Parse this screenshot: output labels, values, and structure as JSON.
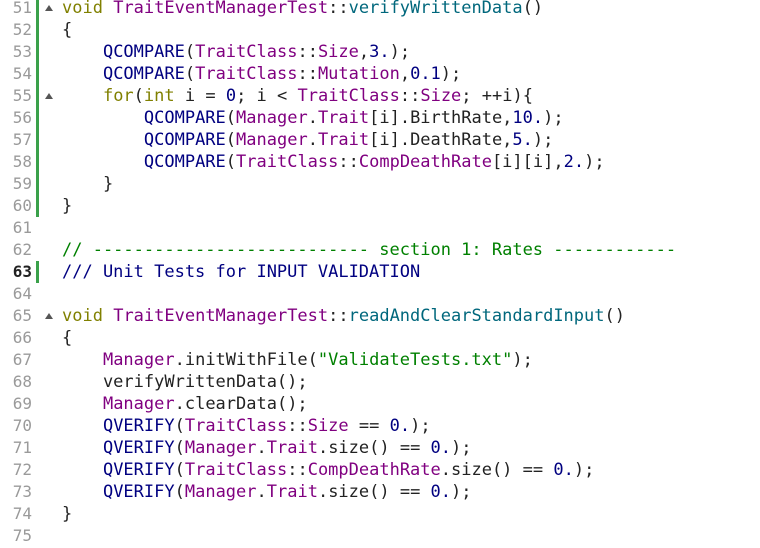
{
  "editor": {
    "current_line": "63",
    "lines": [
      {
        "no": "51",
        "fold": true,
        "changed": true,
        "tokens": [
          [
            "kw",
            "void"
          ],
          [
            "txt",
            " "
          ],
          [
            "cls",
            "TraitEventManagerTest"
          ],
          [
            "txt",
            "::"
          ],
          [
            "fn-def",
            "verifyWrittenData"
          ],
          [
            "txt",
            "()"
          ]
        ]
      },
      {
        "no": "52",
        "fold": false,
        "changed": true,
        "tokens": [
          [
            "txt",
            "{"
          ]
        ]
      },
      {
        "no": "53",
        "fold": false,
        "changed": true,
        "tokens": [
          [
            "txt",
            "    "
          ],
          [
            "mac",
            "QCOMPARE"
          ],
          [
            "txt",
            "("
          ],
          [
            "cls",
            "TraitClass"
          ],
          [
            "txt",
            "::"
          ],
          [
            "cls",
            "Size"
          ],
          [
            "txt",
            ","
          ],
          [
            "num",
            "3."
          ],
          [
            "txt",
            ");"
          ]
        ]
      },
      {
        "no": "54",
        "fold": false,
        "changed": true,
        "tokens": [
          [
            "txt",
            "    "
          ],
          [
            "mac",
            "QCOMPARE"
          ],
          [
            "txt",
            "("
          ],
          [
            "cls",
            "TraitClass"
          ],
          [
            "txt",
            "::"
          ],
          [
            "cls",
            "Mutation"
          ],
          [
            "txt",
            ","
          ],
          [
            "num",
            "0.1"
          ],
          [
            "txt",
            ");"
          ]
        ]
      },
      {
        "no": "55",
        "fold": true,
        "changed": true,
        "tokens": [
          [
            "txt",
            "    "
          ],
          [
            "kw",
            "for"
          ],
          [
            "txt",
            "("
          ],
          [
            "kw",
            "int"
          ],
          [
            "txt",
            " i = "
          ],
          [
            "num",
            "0"
          ],
          [
            "txt",
            "; i < "
          ],
          [
            "cls",
            "TraitClass"
          ],
          [
            "txt",
            "::"
          ],
          [
            "cls",
            "Size"
          ],
          [
            "txt",
            "; ++i){"
          ]
        ]
      },
      {
        "no": "56",
        "fold": false,
        "changed": true,
        "tokens": [
          [
            "txt",
            "        "
          ],
          [
            "mac",
            "QCOMPARE"
          ],
          [
            "txt",
            "("
          ],
          [
            "cls",
            "Manager"
          ],
          [
            "txt",
            "."
          ],
          [
            "cls",
            "Trait"
          ],
          [
            "txt",
            "[i].BirthRate,"
          ],
          [
            "num",
            "10."
          ],
          [
            "txt",
            ");"
          ]
        ]
      },
      {
        "no": "57",
        "fold": false,
        "changed": true,
        "tokens": [
          [
            "txt",
            "        "
          ],
          [
            "mac",
            "QCOMPARE"
          ],
          [
            "txt",
            "("
          ],
          [
            "cls",
            "Manager"
          ],
          [
            "txt",
            "."
          ],
          [
            "cls",
            "Trait"
          ],
          [
            "txt",
            "[i].DeathRate,"
          ],
          [
            "num",
            "5."
          ],
          [
            "txt",
            ");"
          ]
        ]
      },
      {
        "no": "58",
        "fold": false,
        "changed": true,
        "tokens": [
          [
            "txt",
            "        "
          ],
          [
            "mac",
            "QCOMPARE"
          ],
          [
            "txt",
            "("
          ],
          [
            "cls",
            "TraitClass"
          ],
          [
            "txt",
            "::"
          ],
          [
            "cls",
            "CompDeathRate"
          ],
          [
            "txt",
            "[i][i],"
          ],
          [
            "num",
            "2."
          ],
          [
            "txt",
            ");"
          ]
        ]
      },
      {
        "no": "59",
        "fold": false,
        "changed": true,
        "tokens": [
          [
            "txt",
            "    }"
          ]
        ]
      },
      {
        "no": "60",
        "fold": false,
        "changed": true,
        "tokens": [
          [
            "txt",
            "}"
          ]
        ]
      },
      {
        "no": "61",
        "fold": false,
        "changed": false,
        "tokens": []
      },
      {
        "no": "62",
        "fold": false,
        "changed": false,
        "tokens": [
          [
            "com",
            "// --------------------------- section 1: Rates ------------"
          ]
        ]
      },
      {
        "no": "63",
        "fold": false,
        "changed": true,
        "tokens": [
          [
            "com-doc",
            "/// Unit Tests for INPUT VALIDATION"
          ]
        ]
      },
      {
        "no": "64",
        "fold": false,
        "changed": false,
        "tokens": []
      },
      {
        "no": "65",
        "fold": true,
        "changed": false,
        "tokens": [
          [
            "kw",
            "void"
          ],
          [
            "txt",
            " "
          ],
          [
            "cls",
            "TraitEventManagerTest"
          ],
          [
            "txt",
            "::"
          ],
          [
            "fn-def",
            "readAndClearStandardInput"
          ],
          [
            "txt",
            "()"
          ]
        ]
      },
      {
        "no": "66",
        "fold": false,
        "changed": false,
        "tokens": [
          [
            "txt",
            "{"
          ]
        ]
      },
      {
        "no": "67",
        "fold": false,
        "changed": false,
        "tokens": [
          [
            "txt",
            "    "
          ],
          [
            "cls",
            "Manager"
          ],
          [
            "txt",
            ".initWithFile("
          ],
          [
            "str",
            "\"ValidateTests.txt\""
          ],
          [
            "txt",
            ");"
          ]
        ]
      },
      {
        "no": "68",
        "fold": false,
        "changed": false,
        "tokens": [
          [
            "txt",
            "    verifyWrittenData();"
          ]
        ]
      },
      {
        "no": "69",
        "fold": false,
        "changed": false,
        "tokens": [
          [
            "txt",
            "    "
          ],
          [
            "cls",
            "Manager"
          ],
          [
            "txt",
            ".clearData();"
          ]
        ]
      },
      {
        "no": "70",
        "fold": false,
        "changed": false,
        "tokens": [
          [
            "txt",
            "    "
          ],
          [
            "mac",
            "QVERIFY"
          ],
          [
            "txt",
            "("
          ],
          [
            "cls",
            "TraitClass"
          ],
          [
            "txt",
            "::"
          ],
          [
            "cls",
            "Size"
          ],
          [
            "txt",
            " == "
          ],
          [
            "num",
            "0."
          ],
          [
            "txt",
            ");"
          ]
        ]
      },
      {
        "no": "71",
        "fold": false,
        "changed": false,
        "tokens": [
          [
            "txt",
            "    "
          ],
          [
            "mac",
            "QVERIFY"
          ],
          [
            "txt",
            "("
          ],
          [
            "cls",
            "Manager"
          ],
          [
            "txt",
            "."
          ],
          [
            "cls",
            "Trait"
          ],
          [
            "txt",
            ".size() == "
          ],
          [
            "num",
            "0."
          ],
          [
            "txt",
            ");"
          ]
        ]
      },
      {
        "no": "72",
        "fold": false,
        "changed": false,
        "tokens": [
          [
            "txt",
            "    "
          ],
          [
            "mac",
            "QVERIFY"
          ],
          [
            "txt",
            "("
          ],
          [
            "cls",
            "TraitClass"
          ],
          [
            "txt",
            "::"
          ],
          [
            "cls",
            "CompDeathRate"
          ],
          [
            "txt",
            ".size() == "
          ],
          [
            "num",
            "0."
          ],
          [
            "txt",
            ");"
          ]
        ]
      },
      {
        "no": "73",
        "fold": false,
        "changed": false,
        "tokens": [
          [
            "txt",
            "    "
          ],
          [
            "mac",
            "QVERIFY"
          ],
          [
            "txt",
            "("
          ],
          [
            "cls",
            "Manager"
          ],
          [
            "txt",
            "."
          ],
          [
            "cls",
            "Trait"
          ],
          [
            "txt",
            ".size() == "
          ],
          [
            "num",
            "0."
          ],
          [
            "txt",
            ");"
          ]
        ]
      },
      {
        "no": "74",
        "fold": false,
        "changed": false,
        "tokens": [
          [
            "txt",
            "}"
          ]
        ]
      },
      {
        "no": "75",
        "fold": false,
        "changed": false,
        "tokens": []
      }
    ]
  },
  "colors": {
    "keyword": "#808000",
    "class": "#800080",
    "number": "#000080",
    "string": "#008000",
    "comment": "#008000",
    "doc_comment": "#000080",
    "change_bar": "#3aa14a",
    "line_number": "#9a9a9a"
  }
}
